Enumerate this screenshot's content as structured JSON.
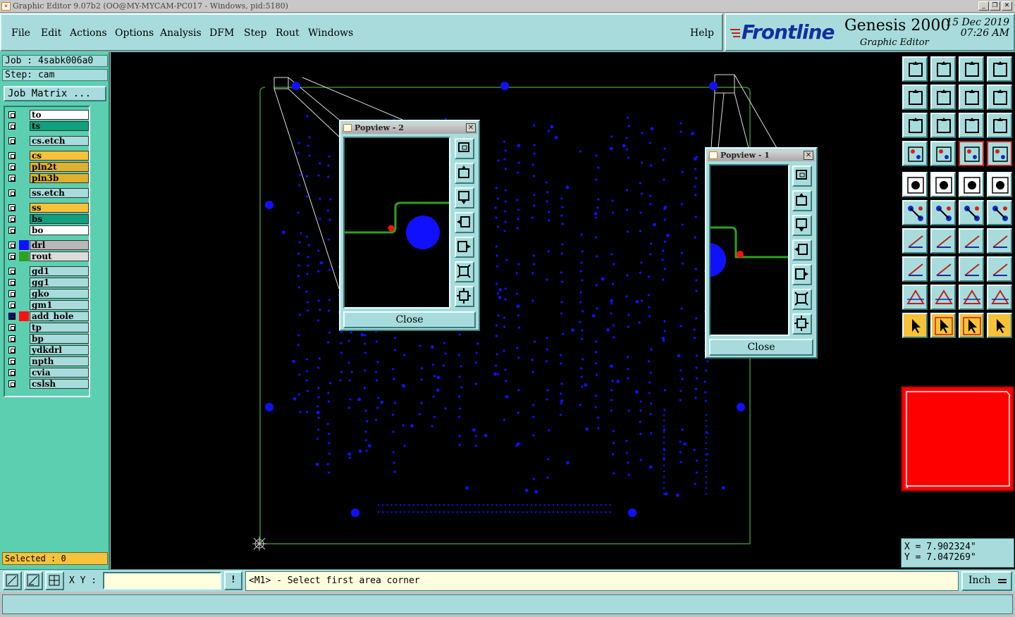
{
  "window": {
    "title": "Graphic Editor 9.07b2 (OO@MY-MYCAM-PC017 - Windows, pid:5180)",
    "buttons": [
      "_",
      "❐",
      "✕"
    ]
  },
  "menu": {
    "items": [
      "File",
      "Edit",
      "Actions",
      "Options",
      "Analysis",
      "DFM",
      "Step",
      "Rout",
      "Windows"
    ],
    "help": "Help"
  },
  "brand": {
    "logo": "Frontline",
    "product": "Genesis 2000",
    "subtitle": "Graphic Editor",
    "date": "15 Dec 2019",
    "time": "07:26 AM"
  },
  "job": {
    "job_line": "Job : 4sabk006a0",
    "step_line": "Step: cam",
    "matrix_button": "Job Matrix ..."
  },
  "layers": [
    {
      "name": "to",
      "bg": "#ffffff",
      "color": ""
    },
    {
      "name": "ts",
      "bg": "#10a080",
      "color": ""
    },
    {
      "name": "cs.etch",
      "bg": "#a8dcdc",
      "color": ""
    },
    {
      "name": "cs",
      "bg": "#f5c23a",
      "color": ""
    },
    {
      "name": "pln2t",
      "bg": "#e0b030",
      "color": ""
    },
    {
      "name": "pln3b",
      "bg": "#e0b030",
      "color": ""
    },
    {
      "name": "ss.etch",
      "bg": "#a8dcdc",
      "color": ""
    },
    {
      "name": "ss",
      "bg": "#f5c23a",
      "color": ""
    },
    {
      "name": "bs",
      "bg": "#10a080",
      "color": ""
    },
    {
      "name": "bo",
      "bg": "#ffffff",
      "color": ""
    },
    {
      "name": "drl",
      "bg": "#b8b8b8",
      "color": "#1010ff"
    },
    {
      "name": "rout",
      "bg": "#dcdcdc",
      "color": "#30a020"
    },
    {
      "name": "gd1",
      "bg": "#a8dcdc",
      "color": ""
    },
    {
      "name": "gg1",
      "bg": "#a8dcdc",
      "color": ""
    },
    {
      "name": "gko",
      "bg": "#a8dcdc",
      "color": ""
    },
    {
      "name": "gm1",
      "bg": "#a8dcdc",
      "color": ""
    },
    {
      "name": "add_hole",
      "bg": "#a8dcdc",
      "color": "#ff1010"
    },
    {
      "name": "tp",
      "bg": "#a8dcdc",
      "color": ""
    },
    {
      "name": "bp",
      "bg": "#a8dcdc",
      "color": ""
    },
    {
      "name": "ydkdrl",
      "bg": "#a8dcdc",
      "color": ""
    },
    {
      "name": "npth",
      "bg": "#a8dcdc",
      "color": ""
    },
    {
      "name": "cvia",
      "bg": "#a8dcdc",
      "color": ""
    },
    {
      "name": "cslsh",
      "bg": "#a8dcdc",
      "color": ""
    }
  ],
  "selected": "Selected : 0",
  "popview2": {
    "title": "Popview - 2",
    "close": "Close"
  },
  "popview1": {
    "title": "Popview - 1",
    "close": "Close"
  },
  "coords": {
    "x": "X = 7.902324\"",
    "y": "Y = 7.047269\""
  },
  "command": {
    "xy_label": "X Y :",
    "xy_value": "",
    "info_button": "!",
    "prompt": "<M1> - Select first area corner",
    "units": "Inch"
  },
  "colors": {
    "panel": "#a8dcdc",
    "layer_panel": "#5ccfb0",
    "drill": "#1010ff",
    "rout": "#30a020",
    "highlight": "#ff1010"
  }
}
